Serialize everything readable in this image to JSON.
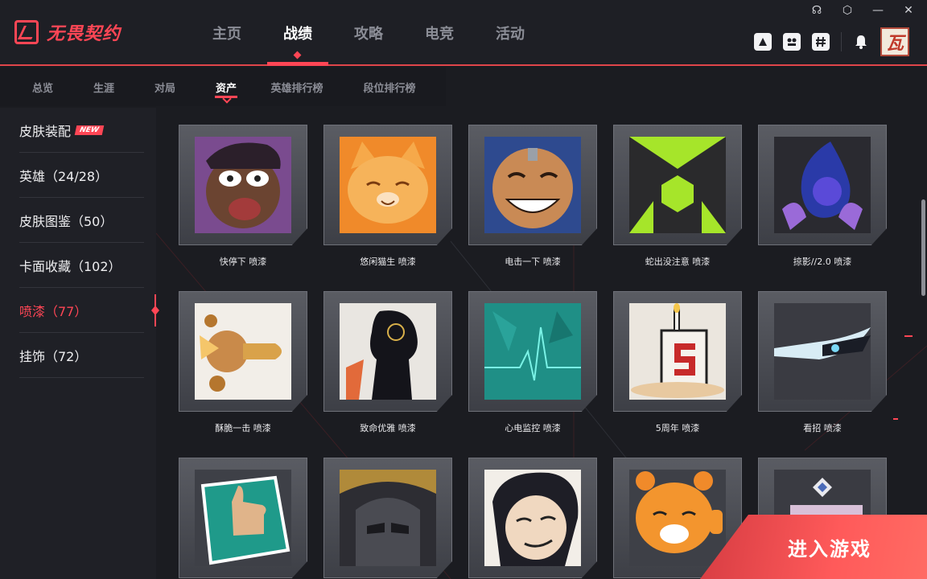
{
  "app": {
    "logo_text": "无畏契约",
    "accent_color": "#ff4655"
  },
  "window_controls": [
    {
      "name": "support-icon",
      "glyph": "☊"
    },
    {
      "name": "settings-icon",
      "glyph": "⬡"
    },
    {
      "name": "minimize-icon",
      "glyph": "—"
    },
    {
      "name": "close-icon",
      "glyph": "✕"
    }
  ],
  "main_nav": [
    {
      "label": "主页",
      "active": false
    },
    {
      "label": "战绩",
      "active": true
    },
    {
      "label": "攻略",
      "active": false
    },
    {
      "label": "电竞",
      "active": false
    },
    {
      "label": "活动",
      "active": false
    }
  ],
  "top_icons": {
    "social": [
      "share-icon",
      "team-icon",
      "hash-icon"
    ],
    "bell": "bell-icon",
    "avatar_text": "瓦"
  },
  "sub_nav": [
    {
      "label": "总览",
      "active": false
    },
    {
      "label": "生涯",
      "active": false
    },
    {
      "label": "对局",
      "active": false
    },
    {
      "label": "资产",
      "active": true
    },
    {
      "label": "英雄排行榜",
      "active": false
    },
    {
      "label": "段位排行榜",
      "active": false
    }
  ],
  "sidebar": {
    "items": [
      {
        "label": "皮肤装配",
        "badge": "NEW",
        "active": false
      },
      {
        "label": "英雄（24/28）",
        "active": false
      },
      {
        "label": "皮肤图鉴（50）",
        "active": false
      },
      {
        "label": "卡面收藏（102）",
        "active": false
      },
      {
        "label": "喷漆（77）",
        "active": true
      },
      {
        "label": "挂饰（72）",
        "active": false
      }
    ]
  },
  "sprays": [
    {
      "label": "快停下 喷漆",
      "icon": "shocked-face-icon"
    },
    {
      "label": "悠闲猫生 喷漆",
      "icon": "cat-face-icon"
    },
    {
      "label": "电击一下 喷漆",
      "icon": "grinning-face-icon"
    },
    {
      "label": "蛇出没注意 喷漆",
      "icon": "hexagon-emblem-icon"
    },
    {
      "label": "掠影//2.0 喷漆",
      "icon": "blue-orb-icon"
    },
    {
      "label": "酥脆一击 喷漆",
      "icon": "bullet-icon"
    },
    {
      "label": "致命优雅 喷漆",
      "icon": "silhouette-icon"
    },
    {
      "label": "心电监控 喷漆",
      "icon": "heartbeat-icon"
    },
    {
      "label": "5周年 喷漆",
      "icon": "cake-five-icon"
    },
    {
      "label": "看招 喷漆",
      "icon": "blade-icon"
    },
    {
      "label": "",
      "icon": "thumbs-up-icon"
    },
    {
      "label": "",
      "icon": "masked-face-icon"
    },
    {
      "label": "",
      "icon": "smirk-face-icon"
    },
    {
      "label": "",
      "icon": "tiger-icon"
    },
    {
      "label": "",
      "icon": "pixel-logo-icon"
    }
  ],
  "enter_game": {
    "label": "进入游戏"
  }
}
